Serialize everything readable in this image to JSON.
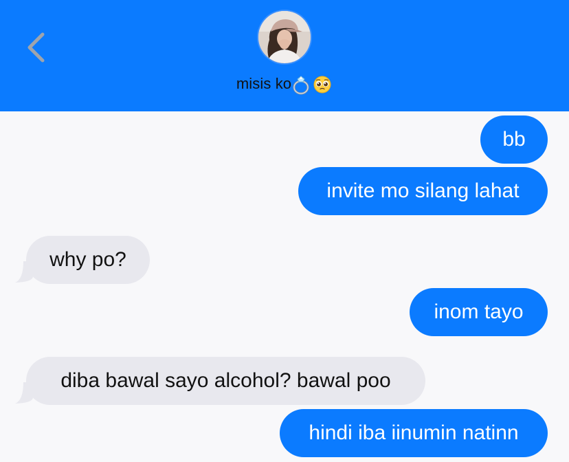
{
  "header": {
    "contact_name": "misis ko",
    "icons": [
      "back-chevron-icon",
      "ring-icon",
      "pleading-face-icon"
    ],
    "background_color": "#0b7bff"
  },
  "messages": [
    {
      "side": "sent",
      "text": "bb"
    },
    {
      "side": "sent",
      "text": "invite mo silang lahat"
    },
    {
      "side": "received",
      "text": "why po?"
    },
    {
      "side": "sent",
      "text": "inom tayo"
    },
    {
      "side": "received",
      "text": "diba bawal sayo alcohol? bawal poo"
    },
    {
      "side": "sent",
      "text": "hindi iba iinumin natinn"
    }
  ],
  "colors": {
    "sent_bubble": "#0b7bff",
    "received_bubble": "#e8e8ee",
    "background": "#f8f8fa"
  }
}
